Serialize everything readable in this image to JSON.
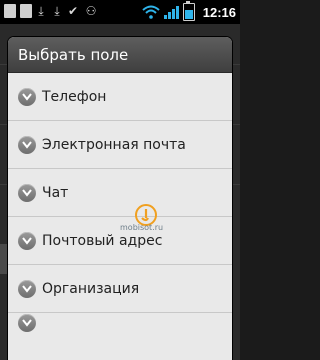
{
  "statusbar": {
    "time": "12:16",
    "icons": [
      "notification-icon",
      "notification-icon",
      "download-icon",
      "download-icon",
      "check-icon",
      "usb-debug-icon",
      "wifi-icon",
      "signal-icon",
      "battery-icon"
    ]
  },
  "dialog": {
    "title": "Выбрать поле",
    "items": [
      {
        "label": "Телефон"
      },
      {
        "label": "Электронная почта"
      },
      {
        "label": "Чат"
      },
      {
        "label": "Почтовый адрес"
      },
      {
        "label": "Организация"
      },
      {
        "label": ""
      }
    ]
  },
  "watermark": {
    "text": "mobisot.ru"
  },
  "colors": {
    "accent": "#2fb4ea",
    "dialog_bg": "#e9e9e9",
    "title_bg": "#4a4a4a"
  }
}
